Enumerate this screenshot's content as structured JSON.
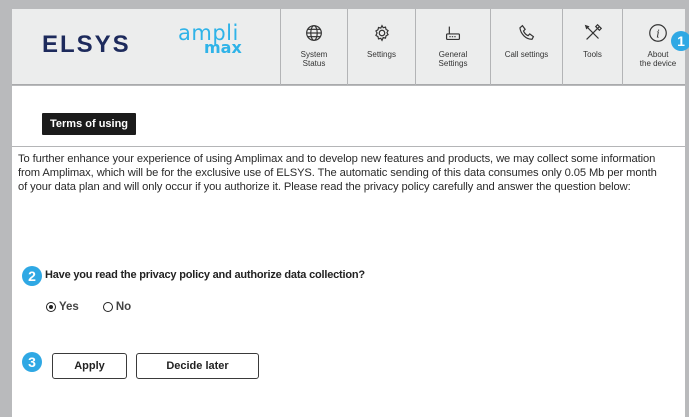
{
  "header": {
    "brand": "ELSYS",
    "product_part1": "ampli",
    "product_part2": "max",
    "nav": [
      {
        "icon": "globe-icon",
        "label_line1": "System",
        "label_line2": "Status"
      },
      {
        "icon": "gear-icon",
        "label_line1": "Settings",
        "label_line2": ""
      },
      {
        "icon": "router-icon",
        "label_line1": "General",
        "label_line2": "Settings"
      },
      {
        "icon": "phone-icon",
        "label_line1": "Call settings",
        "label_line2": ""
      },
      {
        "icon": "tools-icon",
        "label_line1": "Tools",
        "label_line2": ""
      },
      {
        "icon": "info-icon",
        "label_line1": "About",
        "label_line2": "the device"
      }
    ]
  },
  "badges": {
    "b1": "1",
    "b2": "2",
    "b3": "3"
  },
  "terms": {
    "title": "Terms of using",
    "text": "To further enhance your experience of using Amplimax and to develop new features and products, we may collect some information from Amplimax, which will be for the exclusive use of ELSYS. The automatic sending of this data consumes only 0.05 Mb per month of your data plan and will only occur if you authorize it. Please read the privacy policy carefully and answer the question below:",
    "question": "Have you read the privacy policy and authorize data collection?",
    "options": [
      {
        "label": "Yes",
        "selected": true
      },
      {
        "label": "No",
        "selected": false
      }
    ],
    "apply_label": "Apply",
    "decide_later_label": "Decide later"
  },
  "colors": {
    "accent": "#2fa8e4",
    "brand": "#1d2a5c",
    "logo": "#2fb3e8"
  }
}
